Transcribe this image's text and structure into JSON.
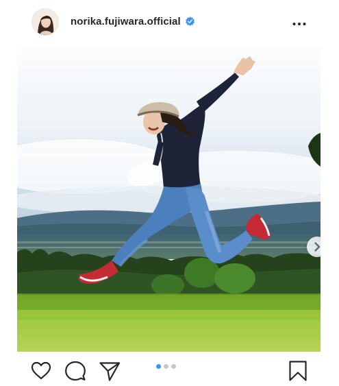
{
  "post": {
    "username": "norika.fujiwara.official",
    "verified": true,
    "carousel": {
      "total": 3,
      "current": 1
    }
  },
  "icons": {
    "more": "more-options-icon",
    "next": "chevron-right-icon",
    "like": "heart-icon",
    "comment": "comment-icon",
    "share": "paper-plane-icon",
    "save": "bookmark-icon",
    "verified": "verified-badge-icon"
  },
  "colors": {
    "verified": "#3897f0",
    "active_dot": "#3897f0",
    "inactive_dot": "#c7c7c7",
    "text": "#262626"
  }
}
